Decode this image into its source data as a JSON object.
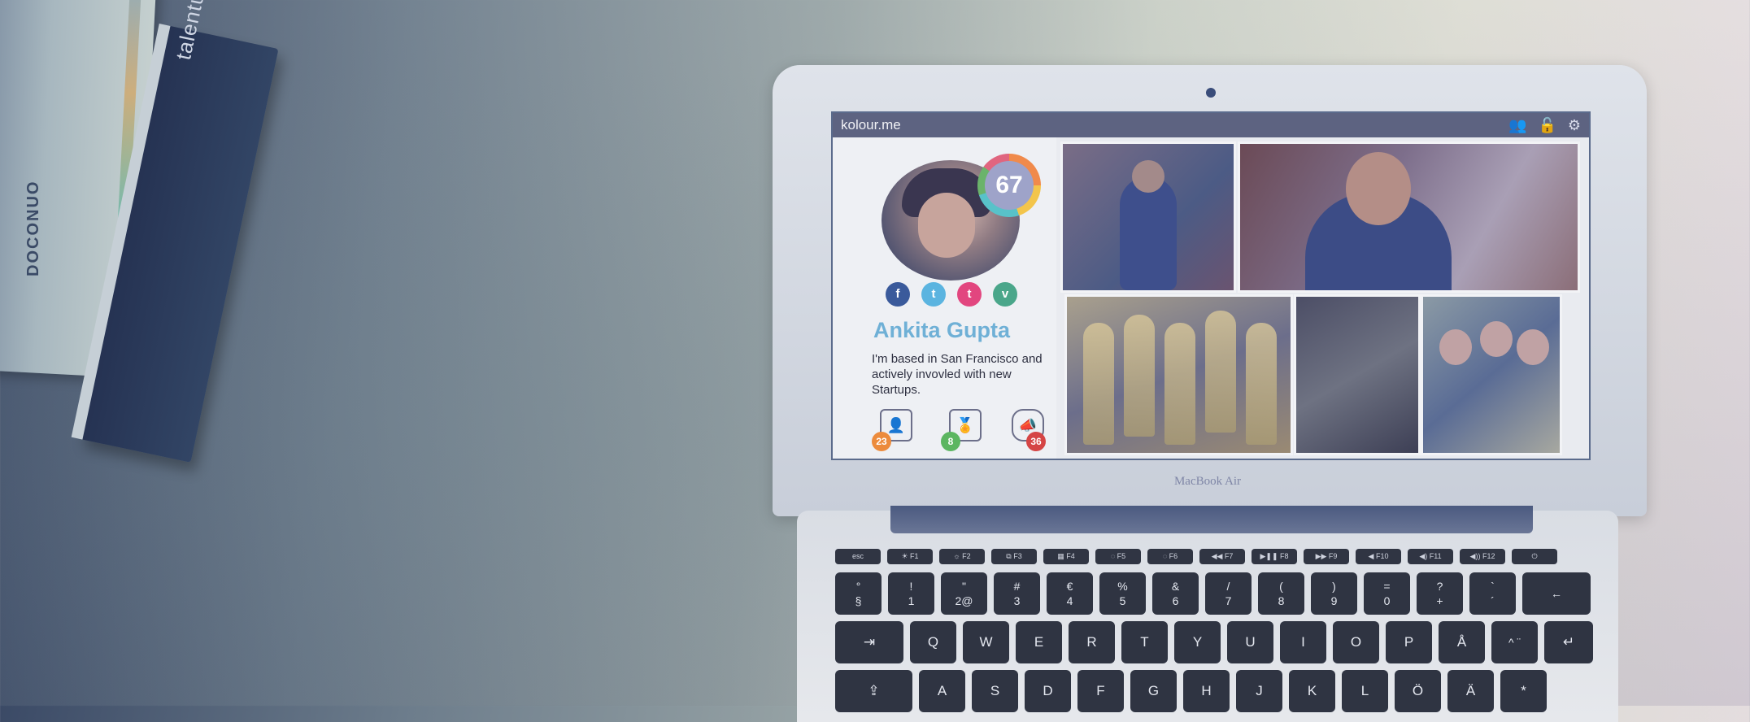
{
  "books": {
    "brand_1": "talentum",
    "brand_2": "DOCONUO"
  },
  "laptop": {
    "model_label": "MacBook Air"
  },
  "app": {
    "logo": "kolour.me",
    "toolbar_icons": [
      "people-icon",
      "unlock-icon",
      "settings-icon"
    ]
  },
  "profile": {
    "score": "67",
    "name": "Ankita Gupta",
    "bio": "I'm based in San Francisco and actively invovled with new Startups.",
    "socials": [
      {
        "icon": "facebook-icon",
        "glyph": "f"
      },
      {
        "icon": "twitter-icon",
        "glyph": "t"
      },
      {
        "icon": "tumblr-icon",
        "glyph": "t"
      },
      {
        "icon": "vimeo-icon",
        "glyph": "v"
      }
    ],
    "badges": [
      {
        "icon": "resume-icon",
        "count": "23"
      },
      {
        "icon": "medal-icon",
        "count": "8"
      },
      {
        "icon": "megaphone-icon",
        "count": "36"
      }
    ]
  },
  "keyboard": {
    "fn_row": [
      "esc",
      "☀ F1",
      "☼ F2",
      "⧉ F3",
      "▦ F4",
      "◌ F5",
      "◌ F6",
      "◀◀ F7",
      "▶❚❚ F8",
      "▶▶ F9",
      "◀ F10",
      "◀) F11",
      "◀)) F12",
      "⏻"
    ],
    "number_row": [
      [
        "°",
        "§"
      ],
      [
        "!",
        "1"
      ],
      [
        "\"",
        "2@"
      ],
      [
        "#",
        "3"
      ],
      [
        "€",
        "4"
      ],
      [
        "%",
        "5"
      ],
      [
        "&",
        "6"
      ],
      [
        "/",
        "7"
      ],
      [
        "(",
        "8"
      ],
      [
        ")",
        "9"
      ],
      [
        "=",
        "0"
      ],
      [
        "?",
        "+"
      ],
      [
        "`",
        "´"
      ],
      [
        "",
        "←"
      ]
    ],
    "top_row": [
      "⇥",
      "Q",
      "W",
      "E",
      "R",
      "T",
      "Y",
      "U",
      "I",
      "O",
      "P",
      "Å",
      "^ ¨",
      "↵"
    ],
    "home_row": [
      "⇪",
      "A",
      "S",
      "D",
      "F",
      "G",
      "H",
      "J",
      "K",
      "L",
      "Ö",
      "Ä",
      "*"
    ]
  }
}
